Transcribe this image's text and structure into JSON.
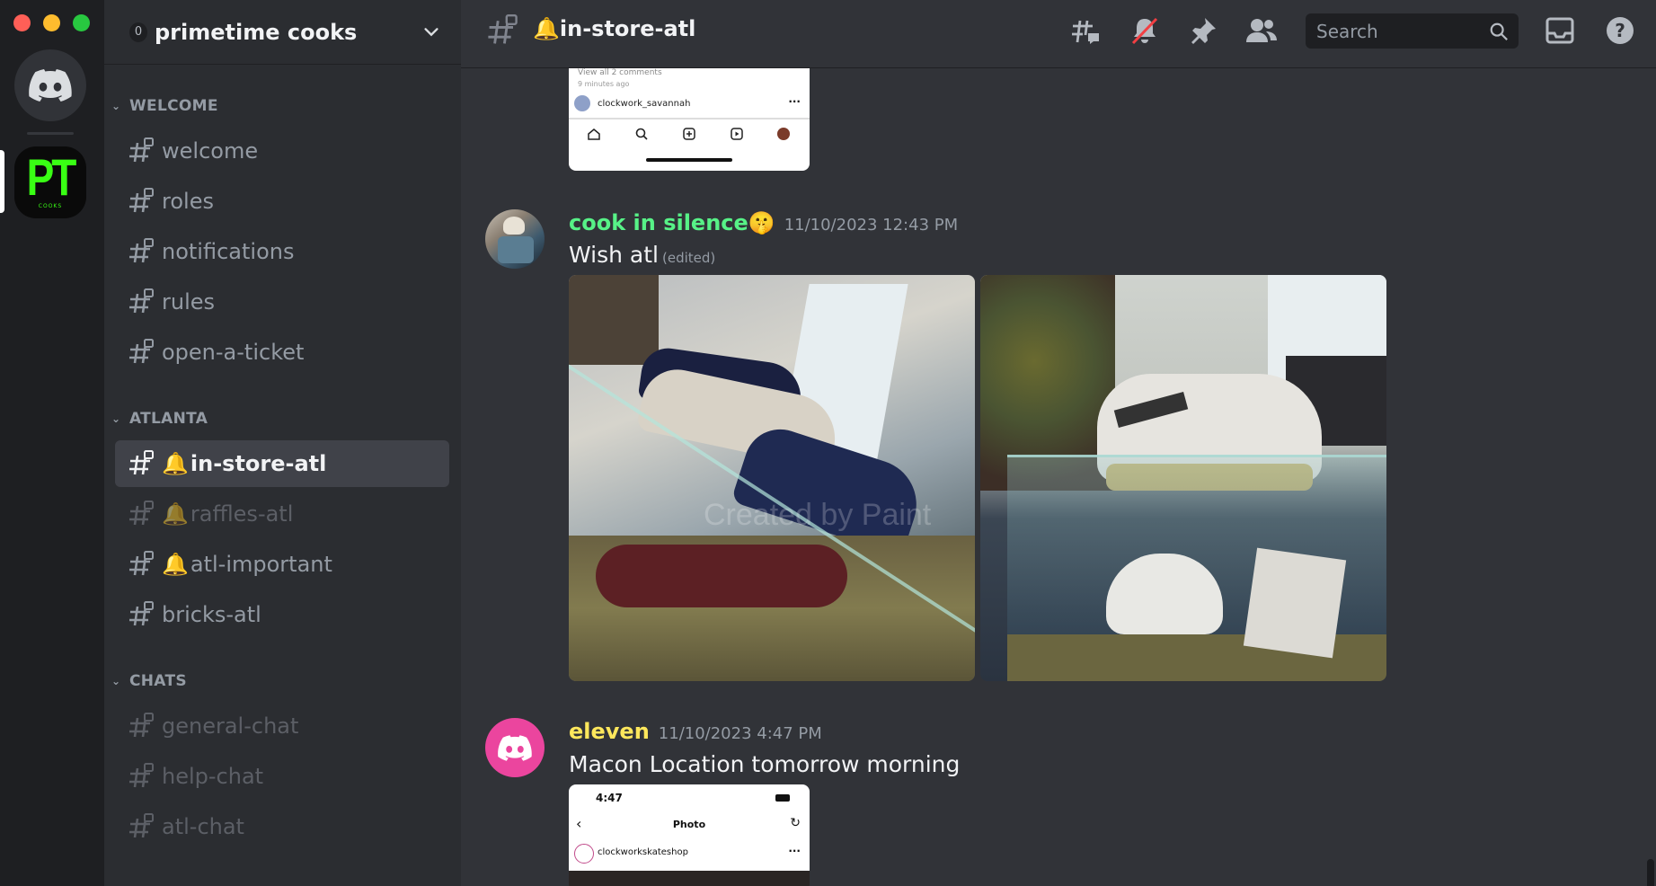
{
  "window": {
    "close_color": "#ff5f57",
    "minimize_color": "#febc2e",
    "maximize_color": "#28c840"
  },
  "server": {
    "name": "primetime cooks",
    "badge": "0",
    "icon_text": "PT",
    "icon_subtext": "COOKS"
  },
  "categories": [
    {
      "name": "WELCOME"
    },
    {
      "name": "ATLANTA"
    },
    {
      "name": "CHATS"
    }
  ],
  "channels": [
    {
      "name": "welcome"
    },
    {
      "name": "roles"
    },
    {
      "name": "notifications"
    },
    {
      "name": "rules"
    },
    {
      "name": "open-a-ticket"
    },
    {
      "name": "in-store-atl",
      "bell": "🔔"
    },
    {
      "name": "raffles-atl",
      "bell": "🔔"
    },
    {
      "name": "atl-important",
      "bell": "🔔"
    },
    {
      "name": "bricks-atl"
    },
    {
      "name": "general-chat"
    },
    {
      "name": "help-chat"
    },
    {
      "name": "atl-chat"
    }
  ],
  "header": {
    "channel_bell": "🔔",
    "channel_name": "in-store-atl",
    "search_placeholder": "Search",
    "icons": [
      "threads-icon",
      "mute-bell-icon",
      "pin-icon",
      "members-icon",
      "inbox-icon",
      "help-icon"
    ]
  },
  "prev_attachment": {
    "line1": "View all 2 comments",
    "line2": "9 minutes ago",
    "user": "clockwork_savannah",
    "dots": "···"
  },
  "messages": [
    {
      "author": "cook in silence🤫",
      "author_color": "#57f287",
      "timestamp": "11/10/2023 12:43 PM",
      "text": "Wish atl",
      "edited": "(edited)",
      "watermark": "Created by Paint"
    },
    {
      "author": "eleven",
      "author_color": "#fee75c",
      "timestamp": "11/10/2023 4:47 PM",
      "text": "Macon Location tomorrow morning",
      "phone": {
        "time": "4:47",
        "title": "Photo",
        "user": "clockworkskateshop",
        "dots": "···"
      }
    }
  ]
}
